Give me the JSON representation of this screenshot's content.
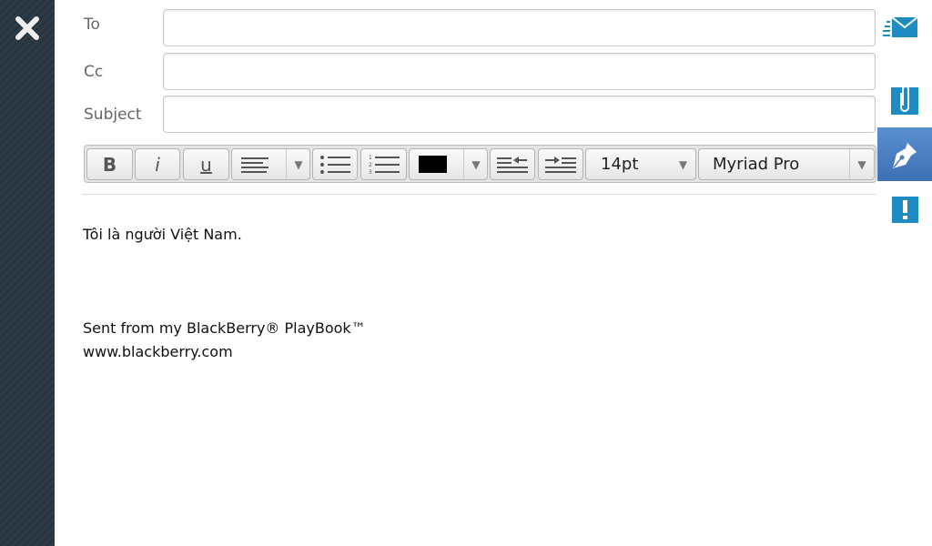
{
  "header": {
    "to_label": "To",
    "cc_label": "Cc",
    "subject_label": "Subject",
    "to_value": "",
    "cc_value": "",
    "subject_value": ""
  },
  "toolbar": {
    "bold": "B",
    "italic": "i",
    "underline": "u",
    "text_color": "#000000",
    "font_size": "14pt",
    "font_family": "Myriad Pro"
  },
  "body": {
    "line1": "Tôi là người Việt Nam.",
    "signature1": "Sent from my BlackBerry® PlayBook™",
    "signature2": "www.blackberry.com"
  },
  "right_bar": {
    "icons": [
      "send-icon",
      "attach-icon",
      "compose-icon",
      "priority-icon"
    ],
    "selected": "compose-icon",
    "accent": "#1e8bc3",
    "selected_bg": "#4a7fc0"
  }
}
